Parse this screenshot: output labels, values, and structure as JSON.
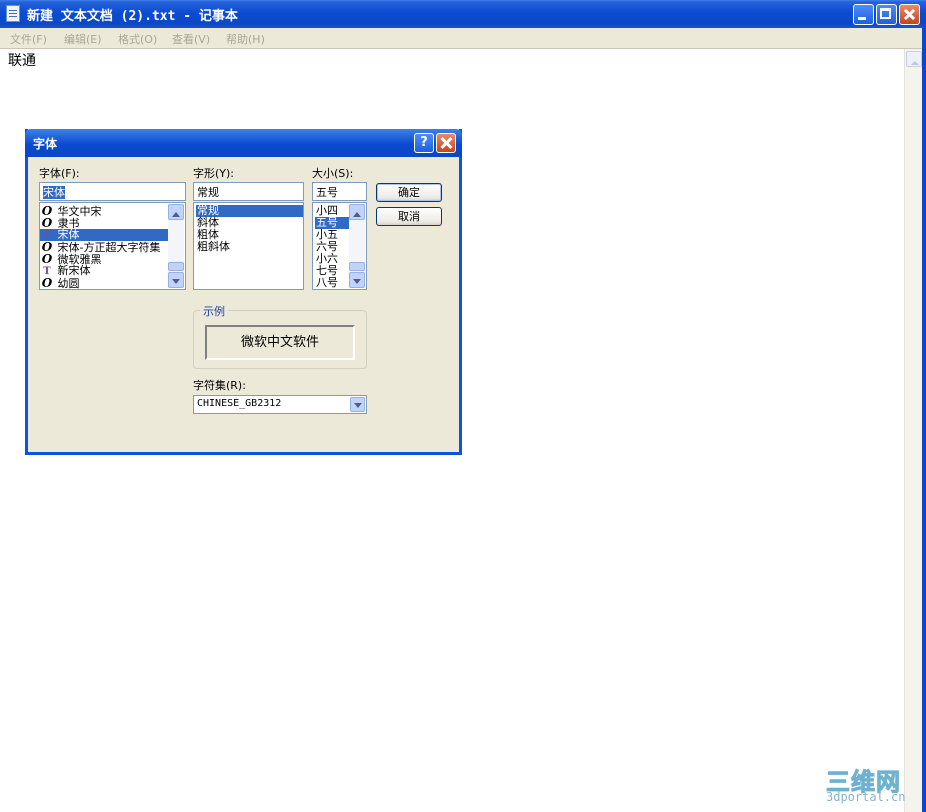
{
  "window": {
    "title": "新建 文本文档 (2).txt - 记事本"
  },
  "menu": [
    "文件(F)",
    "编辑(E)",
    "格式(O)",
    "查看(V)",
    "帮助(H)"
  ],
  "editor": {
    "content": "联通"
  },
  "font_dialog": {
    "title": "字体",
    "font_label": "字体(F):",
    "font_value": "宋体",
    "fonts": [
      {
        "name": "华文中宋",
        "icon": "opentype-icon"
      },
      {
        "name": "隶书",
        "icon": "opentype-icon"
      },
      {
        "name": "宋体",
        "icon": "truetype-icon",
        "selected": true
      },
      {
        "name": "宋体-方正超大字符集",
        "icon": "opentype-icon"
      },
      {
        "name": "微软雅黑",
        "icon": "opentype-icon"
      },
      {
        "name": "新宋体",
        "icon": "truetype-icon"
      },
      {
        "name": "幼圆",
        "icon": "opentype-icon"
      }
    ],
    "style_label": "字形(Y):",
    "style_value": "常规",
    "styles": [
      "常规",
      "斜体",
      "粗体",
      "粗斜体"
    ],
    "size_label": "大小(S):",
    "size_value": "五号",
    "sizes": [
      "小四",
      "五号",
      "小五",
      "六号",
      "小六",
      "七号",
      "八号"
    ],
    "ok": "确定",
    "cancel": "取消",
    "sample_legend": "示例",
    "sample_text": "微软中文软件",
    "charset_label": "字符集(R):",
    "charset_value": "CHINESE_GB2312"
  },
  "watermark": {
    "brand": "三维网",
    "domain": "3dportal.cn"
  }
}
